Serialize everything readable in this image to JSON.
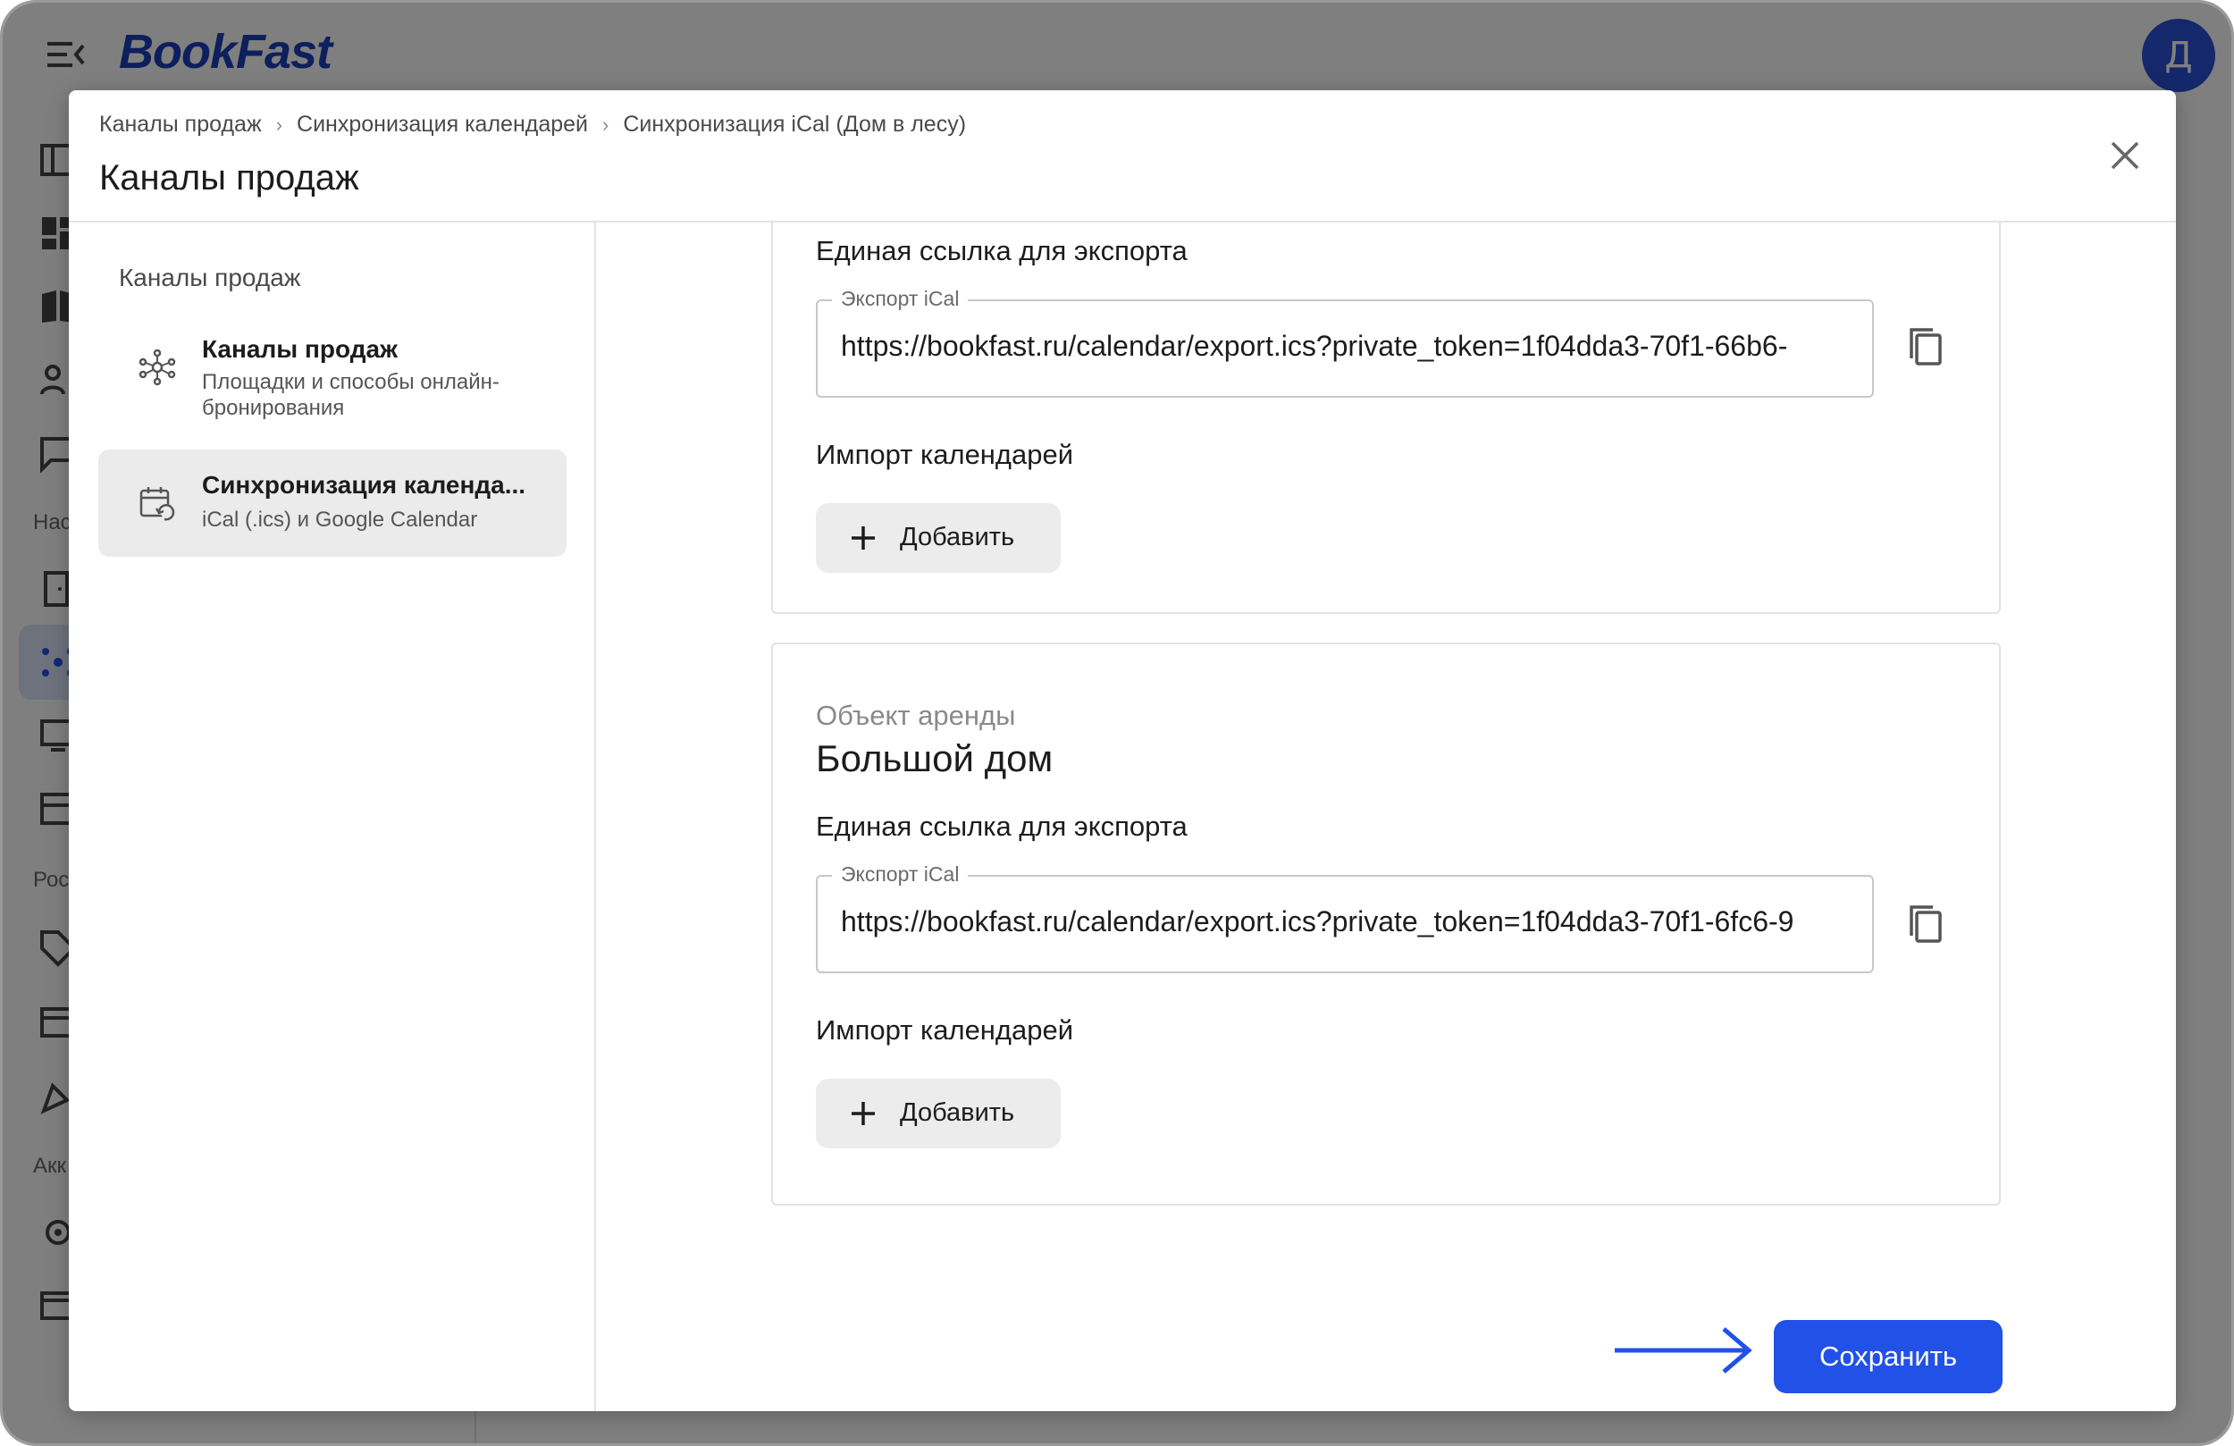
{
  "app": {
    "logo": "BookFast",
    "avatar_initial": "Д",
    "sidebar_sections": [
      "Нас",
      "Рос",
      "Акк"
    ]
  },
  "modal": {
    "breadcrumb": [
      "Каналы продаж",
      "Синхронизация календарей",
      "Синхронизация iCal (Дом в лесу)"
    ],
    "title": "Каналы продаж",
    "nav": {
      "heading": "Каналы продаж",
      "items": [
        {
          "title": "Каналы продаж",
          "subtitle": "Площадки и способы онлайн-бронирования",
          "icon": "network-icon"
        },
        {
          "title": "Синхронизация календа...",
          "subtitle": "iCal (.ics) и Google Calendar",
          "icon": "calendar-sync-icon"
        }
      ]
    },
    "cards": [
      {
        "export_section_label": "Единая ссылка для экспорта",
        "field_legend": "Экспорт iCal",
        "export_url": "https://bookfast.ru/calendar/export.ics?private_token=1f04dda3-70f1-66b6-",
        "import_section_label": "Импорт календарей",
        "add_label": "Добавить"
      },
      {
        "object_label": "Объект аренды",
        "object_name": "Большой дом",
        "export_section_label": "Единая ссылка для экспорта",
        "field_legend": "Экспорт iCal",
        "export_url": "https://bookfast.ru/calendar/export.ics?private_token=1f04dda3-70f1-6fc6-9",
        "import_section_label": "Импорт календарей",
        "add_label": "Добавить"
      }
    ],
    "save_label": "Сохранить"
  },
  "colors": {
    "accent": "#2251e8",
    "logo": "#1b3fb8",
    "overlay": "rgba(0,0,0,0.5)"
  }
}
